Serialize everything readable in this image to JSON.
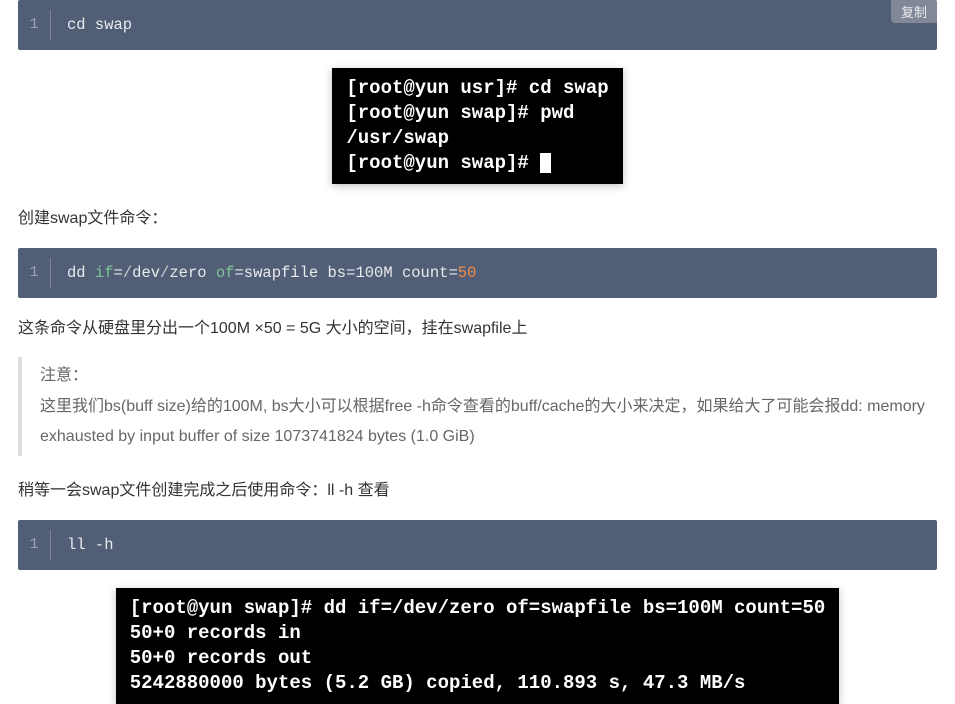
{
  "copy_label": "复制",
  "code_block_1": {
    "line_no": "1",
    "text": "cd swap"
  },
  "terminal_1": {
    "lines": [
      "[root@yun usr]# cd swap",
      "[root@yun swap]# pwd",
      "/usr/swap",
      "[root@yun swap]# "
    ]
  },
  "para_1": "创建swap文件命令：",
  "code_block_2": {
    "line_no": "1",
    "tokens": {
      "t0": "dd ",
      "t1": "if",
      "t2": "=",
      "t3": "/",
      "t4": "dev",
      "t5": "/",
      "t6": "zero ",
      "t7": "of",
      "t8": "=",
      "t9": "swapfile bs",
      "t10": "=",
      "t11": "100M count",
      "t12": "=",
      "t13": "50"
    }
  },
  "para_2": "这条命令从硬盘里分出一个100M ×50 = 5G 大小的空间，挂在swapfile上",
  "note": {
    "line1": "注意：",
    "line2": "这里我们bs(buff size)给的100M, bs大小可以根据free -h命令查看的buff/cache的大小来决定，如果给大了可能会报dd: memory exhausted by input buffer of size 1073741824 bytes (1.0 GiB)"
  },
  "para_3": "稍等一会swap文件创建完成之后使用命令：ll -h 查看",
  "code_block_3": {
    "line_no": "1",
    "tokens": {
      "t0": "ll ",
      "t1": "-",
      "t2": "h"
    }
  },
  "terminal_2": {
    "lines": [
      "[root@yun swap]# dd if=/dev/zero of=swapfile bs=100M count=50",
      "50+0 records in",
      "50+0 records out",
      "5242880000 bytes (5.2 GB) copied, 110.893 s, 47.3 MB/s"
    ]
  }
}
